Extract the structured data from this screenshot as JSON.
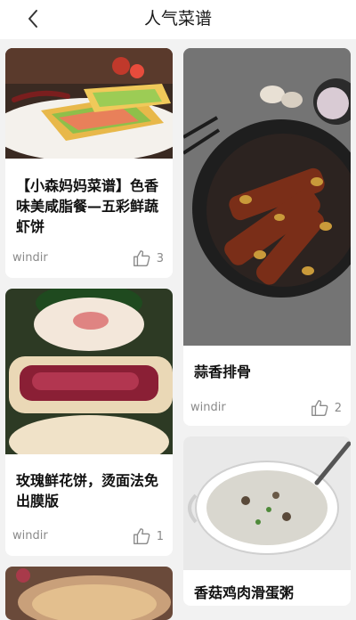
{
  "header": {
    "title": "人气菜谱"
  },
  "icons": {
    "back": "chevron-left-icon",
    "like": "thumbs-up-icon"
  },
  "recipes": [
    {
      "title": "【小森妈妈菜谱】色香味美咸脂餐—五彩鲜蔬虾饼",
      "author": "windir",
      "likes": "3"
    },
    {
      "title": "蒜香排骨",
      "author": "windir",
      "likes": "2"
    },
    {
      "title": "玫瑰鲜花饼，烫面法免出膜版",
      "author": "windir",
      "likes": "1"
    },
    {
      "title": "香菇鸡肉滑蛋粥",
      "author": "",
      "likes": ""
    }
  ]
}
